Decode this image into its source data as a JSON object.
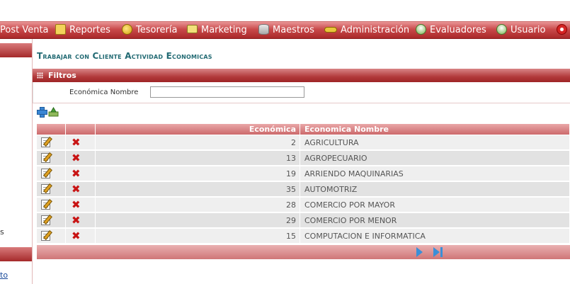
{
  "menu": {
    "items": [
      {
        "label": "Post Venta",
        "icon": "none"
      },
      {
        "label": "Reportes",
        "icon": "document-icon"
      },
      {
        "label": "Tesorería",
        "icon": "coin-icon"
      },
      {
        "label": "Marketing",
        "icon": "screen-icon"
      },
      {
        "label": "Maestros",
        "icon": "database-icon"
      },
      {
        "label": "Administración",
        "icon": "key-icon"
      },
      {
        "label": "Evaluadores",
        "icon": "people-icon"
      },
      {
        "label": "Usuario",
        "icon": "people-icon"
      }
    ]
  },
  "sidebar": {
    "fragment_s": "s",
    "fragment_link": "to"
  },
  "page": {
    "title": "Trabajar con Cliente Actividad Economicas"
  },
  "filter": {
    "header": "Filtros",
    "label": "Económica Nombre",
    "value": ""
  },
  "grid": {
    "headers": {
      "code": "Económica",
      "name": "Economica Nombre"
    },
    "rows": [
      {
        "code": "2",
        "name": "AGRICULTURA"
      },
      {
        "code": "13",
        "name": "AGROPECUARIO"
      },
      {
        "code": "19",
        "name": "ARRIENDO MAQUINARIAS"
      },
      {
        "code": "35",
        "name": "AUTOMOTRIZ"
      },
      {
        "code": "28",
        "name": "COMERCIO POR MAYOR"
      },
      {
        "code": "29",
        "name": "COMERCIO POR MENOR"
      },
      {
        "code": "15",
        "name": "COMPUTACION E INFORMATICA"
      }
    ]
  },
  "colors": {
    "menu_bar": "#b23a3b",
    "title": "#226a73",
    "grid_header": "#cc6a6b",
    "delete": "#c81414",
    "pager": "#3a8fd8"
  }
}
